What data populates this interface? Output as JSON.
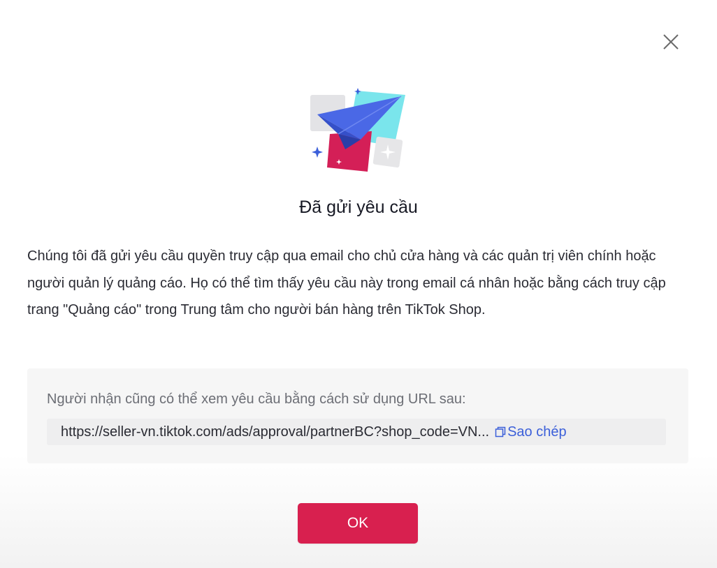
{
  "dialog": {
    "title": "Đã gửi yêu cầu",
    "message": "Chúng tôi đã gửi yêu cầu quyền truy cập qua email cho chủ cửa hàng và các quản trị viên chính hoặc người quản lý quảng cáo. Họ có thể tìm thấy yêu cầu này trong email cá nhân hoặc bằng cách truy cập trang \"Quảng cáo\" trong Trung tâm cho người bán hàng trên TikTok Shop.",
    "url_hint": "Người nhận cũng có thể xem yêu cầu bằng cách sử dụng URL sau:",
    "url": "https://seller-vn.tiktok.com/ads/approval/partnerBC?shop_code=VN...",
    "copy_label": "Sao chép",
    "ok_label": "OK"
  },
  "icons": {
    "close": "close-icon",
    "hero": "paper-plane-illustration",
    "copy": "copy-icon"
  },
  "colors": {
    "primary": "#d8204f",
    "link": "#3b5fd9",
    "text": "#2a2b33",
    "muted": "#6c6e75"
  }
}
